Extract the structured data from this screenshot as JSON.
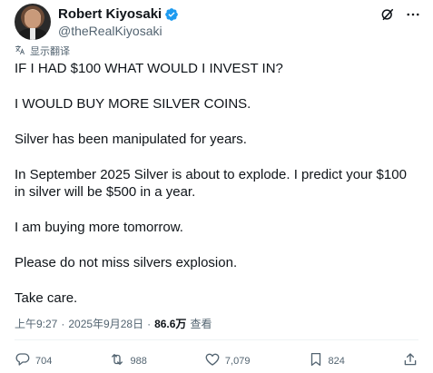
{
  "author": {
    "display_name": "Robert Kiyosaki",
    "handle": "@theRealKiyosaki"
  },
  "header_actions": [
    "grok-icon",
    "more-icon"
  ],
  "translate_label": "显示翻译",
  "post": {
    "paragraphs": [
      "IF I HAD $100 WHAT WOULD I INVEST IN?",
      "I WOULD BUY MORE SILVER COINS.",
      "Silver has been manipulated for years.",
      "In September 2025 Silver is about to explode.  I predict your $100 in silver will be $500 in a year.",
      "I am buying more tomorrow.",
      "Please do not miss silvers explosion.",
      "Take care."
    ]
  },
  "meta": {
    "time": "上午9:27",
    "separator": "·",
    "date": "2025年9月28日",
    "views_count": "86.6万",
    "views_label": "查看"
  },
  "actions": {
    "replies": "704",
    "reposts": "988",
    "likes": "7,079",
    "bookmarks": "824"
  },
  "colors": {
    "verified": "#1d9bf0",
    "text": "#0f1419",
    "secondary": "#536471"
  }
}
